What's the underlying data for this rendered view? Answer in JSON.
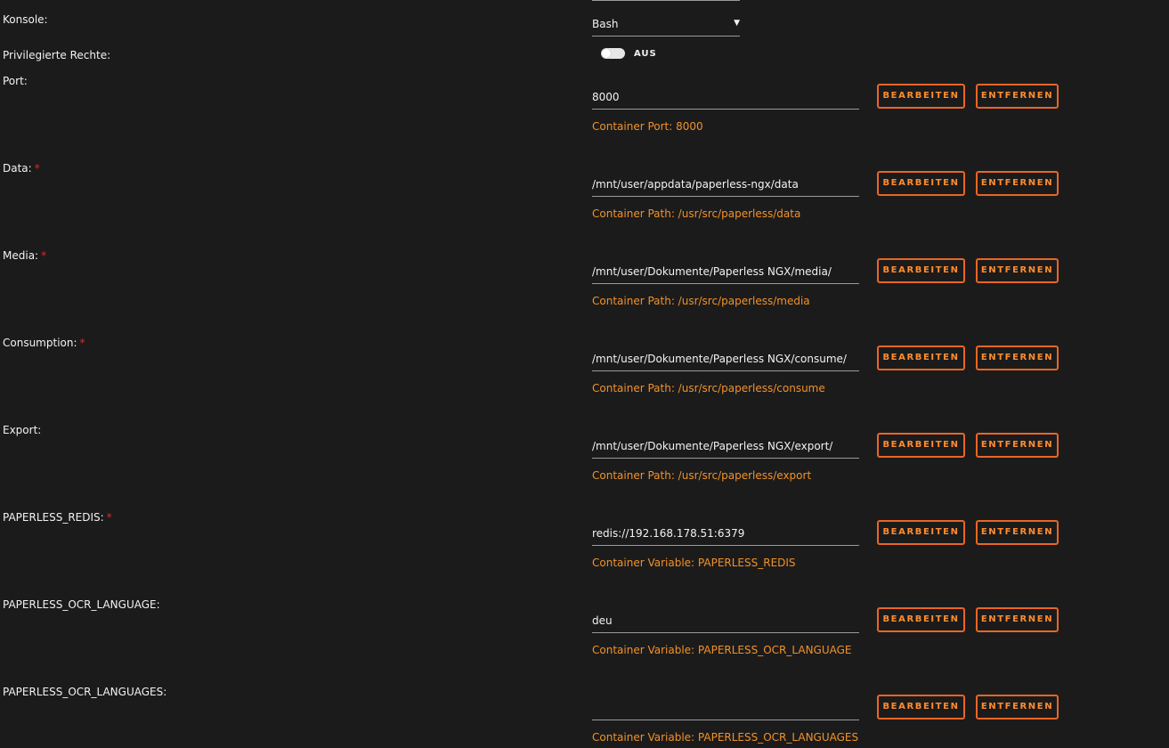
{
  "settings": {
    "console": {
      "label": "Konsole:",
      "value": "Bash",
      "arrow": "▼"
    },
    "privileged": {
      "label": "Privilegierte Rechte:",
      "toggle_state": "AUS"
    }
  },
  "buttons": {
    "edit": "BEARBEITEN",
    "remove": "ENTFERNEN"
  },
  "required_marker": "*",
  "rows": [
    {
      "label": "Port:",
      "required": false,
      "value": "8000",
      "hint": "Container Port: 8000"
    },
    {
      "label": "Data:",
      "required": true,
      "value": "/mnt/user/appdata/paperless-ngx/data",
      "hint": "Container Path: /usr/src/paperless/data"
    },
    {
      "label": "Media:",
      "required": true,
      "value": "/mnt/user/Dokumente/Paperless NGX/media/",
      "hint": "Container Path: /usr/src/paperless/media"
    },
    {
      "label": "Consumption:",
      "required": true,
      "value": "/mnt/user/Dokumente/Paperless NGX/consume/",
      "hint": "Container Path: /usr/src/paperless/consume"
    },
    {
      "label": "Export:",
      "required": false,
      "value": "/mnt/user/Dokumente/Paperless NGX/export/",
      "hint": "Container Path: /usr/src/paperless/export"
    },
    {
      "label": "PAPERLESS_REDIS:",
      "required": true,
      "value": "redis://192.168.178.51:6379",
      "hint": "Container Variable: PAPERLESS_REDIS"
    },
    {
      "label": "PAPERLESS_OCR_LANGUAGE:",
      "required": false,
      "value": "deu",
      "hint": "Container Variable: PAPERLESS_OCR_LANGUAGE"
    },
    {
      "label": "PAPERLESS_OCR_LANGUAGES:",
      "required": false,
      "value": "",
      "hint": "Container Variable: PAPERLESS_OCR_LANGUAGES"
    }
  ],
  "colors": {
    "background": "#1c1b1b",
    "accent": "#ff8c2f",
    "hint": "#f0922a",
    "required": "#e22828"
  }
}
